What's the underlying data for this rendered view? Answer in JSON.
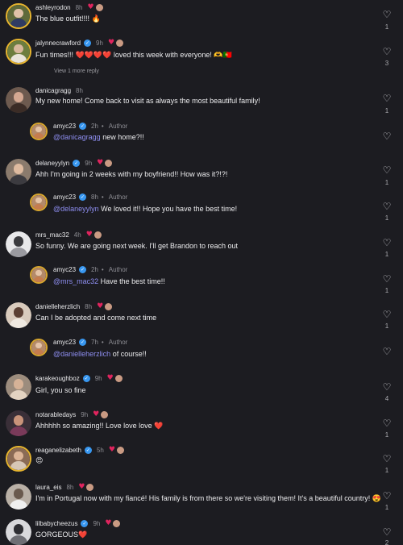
{
  "icons": {
    "like": "heart-outline-icon",
    "liked": "heart-filled-icon",
    "verified": "verified-badge-icon"
  },
  "colors": {
    "background": "#1c1c21",
    "mention": "#8e8ef0",
    "verified": "#3897f0",
    "heart": "#e0245e"
  },
  "comments": [
    {
      "user": "ashleyrodon",
      "time": "8h",
      "text": "The blue outfit!!!! 🔥",
      "likes": "1"
    },
    {
      "user": "jalynnecrawford",
      "verified": "✓",
      "time": "9h",
      "text": "Fun times!!! ❤️❤️❤️❤️ loved this week with everyone! 🫶🇵🇹",
      "likes": "3",
      "view_replies": "View 1 more reply"
    },
    {
      "user": "danicagragg",
      "time": "8h",
      "text": "My new home! Come back to visit as always the most beautiful family!",
      "likes": "1"
    },
    {
      "user": "amyc23",
      "verified": "✓",
      "time": "2h",
      "author": "Author",
      "mention": "@danicagragg",
      "text": " new home?!!"
    },
    {
      "user": "delaneyylyn",
      "verified": "✓",
      "time": "9h",
      "text": "Ahh I'm going in 2 weeks with my boyfriend!! How was it?!?!",
      "likes": "1"
    },
    {
      "user": "amyc23",
      "verified": "✓",
      "time": "8h",
      "author": "Author",
      "mention": "@delaneyylyn",
      "text": " We loved it!! Hope you have the best time!",
      "likes": "1"
    },
    {
      "user": "mrs_mac32",
      "time": "4h",
      "text": "So funny. We are going next week. I'll get Brandon to reach out",
      "likes": "1"
    },
    {
      "user": "amyc23",
      "verified": "✓",
      "time": "2h",
      "author": "Author",
      "mention": "@mrs_mac32",
      "text": " Have the best time!!",
      "likes": "1"
    },
    {
      "user": "danielleherzlich",
      "time": "8h",
      "text": "Can I be adopted and come next time",
      "likes": "1"
    },
    {
      "user": "amyc23",
      "verified": "✓",
      "time": "7h",
      "author": "Author",
      "mention": "@danielleherzlich",
      "text": " of course!!"
    },
    {
      "user": "karakeoughboz",
      "verified": "✓",
      "time": "9h",
      "text": "Girl, you so fine",
      "likes": "4"
    },
    {
      "user": "notarabledays",
      "time": "9h",
      "text": "Ahhhhh so amazing!! Love love love ❤️",
      "likes": "1"
    },
    {
      "user": "reaganelizabeth",
      "verified": "✓",
      "time": "5h",
      "text": "😍",
      "likes": "1"
    },
    {
      "user": "laura_eis",
      "time": "8h",
      "text": "I'm in Portugal now with my fiancé! His family is from there so we're visiting them! It's a beautiful country! 😍",
      "likes": "1"
    },
    {
      "user": "lilbabycheezus",
      "verified": "✓",
      "time": "9h",
      "text": "GORGEOUS❤️",
      "likes": "2"
    }
  ]
}
